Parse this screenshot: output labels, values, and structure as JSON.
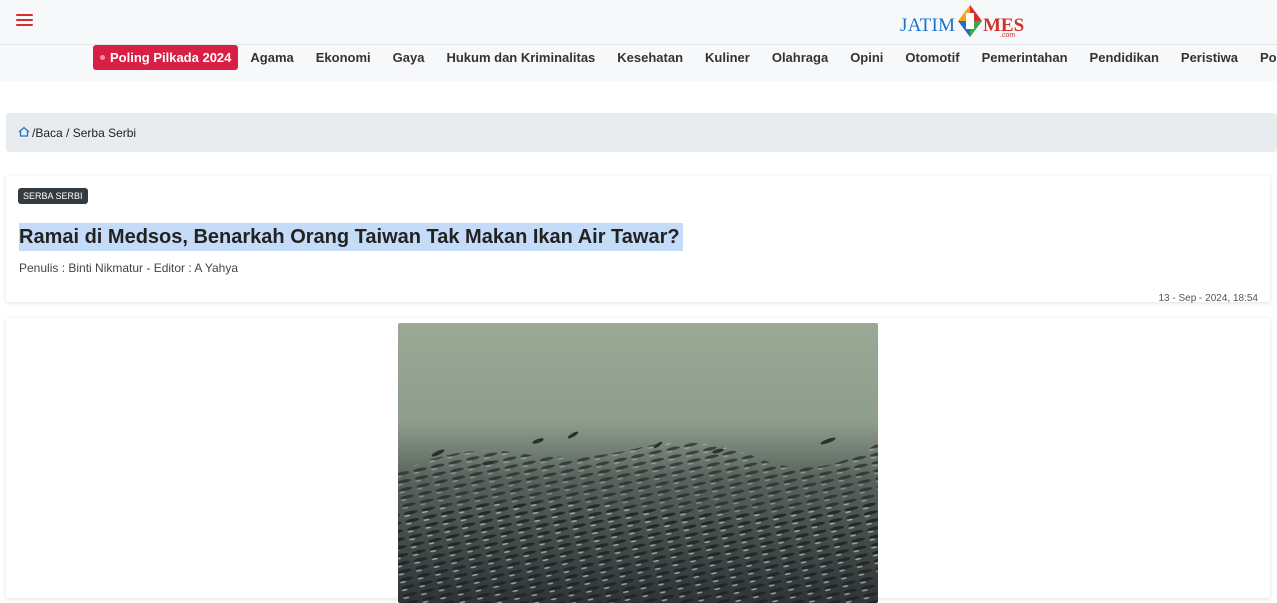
{
  "header": {
    "logo_left": "JATIM",
    "logo_right": "MES",
    "logo_suffix": ".com"
  },
  "nav": {
    "items": [
      {
        "label": "Poling Pilkada 2024"
      },
      {
        "label": "Agama"
      },
      {
        "label": "Ekonomi"
      },
      {
        "label": "Gaya"
      },
      {
        "label": "Hukum dan Kriminalitas"
      },
      {
        "label": "Kesehatan"
      },
      {
        "label": "Kuliner"
      },
      {
        "label": "Olahraga"
      },
      {
        "label": "Opini"
      },
      {
        "label": "Otomotif"
      },
      {
        "label": "Pemerintahan"
      },
      {
        "label": "Pendidikan"
      },
      {
        "label": "Peristiwa"
      },
      {
        "label": "Politik"
      }
    ]
  },
  "breadcrumb": {
    "sep1": "/ ",
    "item1": "Baca",
    "sep2": " / ",
    "item2": "Serba Serbi"
  },
  "article": {
    "category": "SERBA SERBI",
    "title": "Ramai di Medsos, Benarkah Orang Taiwan Tak Makan Ikan Air Tawar?",
    "byline": "Penulis : Binti Nikmatur - Editor : A Yahya",
    "date": "13 - Sep - 2024, 18:54"
  },
  "colors": {
    "accent": "#d81f45",
    "brand_blue": "#1a73c8",
    "highlight": "#c5dcf9"
  }
}
